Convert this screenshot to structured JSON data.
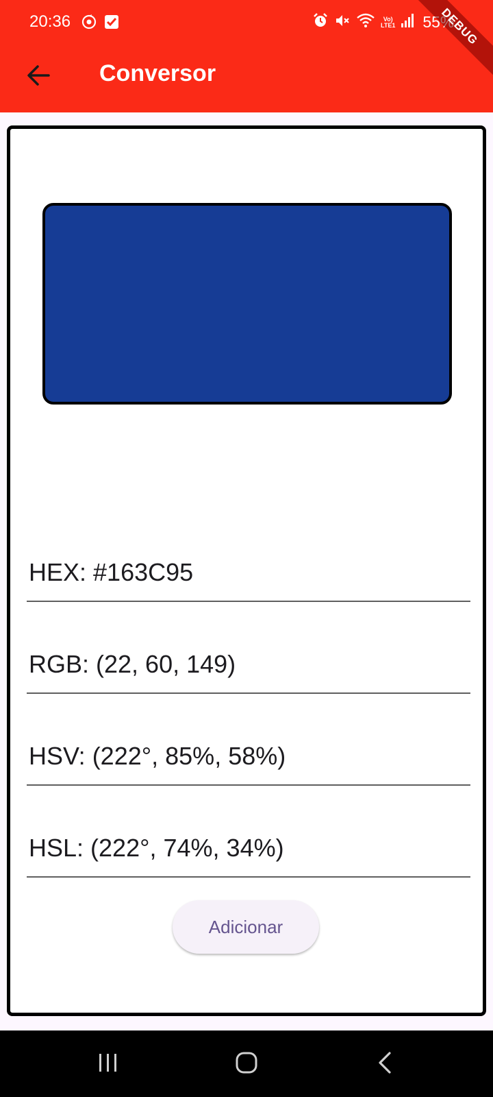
{
  "status_bar": {
    "time": "20:36",
    "battery": "55%",
    "volte_top": "Vo)",
    "volte_bottom": "LTE1",
    "icons": [
      "sync-icon",
      "checkbox-notification-icon",
      "alarm-icon",
      "mute-icon",
      "wifi-icon",
      "volte-icon",
      "signal-icon"
    ]
  },
  "debug_banner": "DEBUG",
  "app_bar": {
    "back_icon": "arrow-back-icon",
    "title": "Conversor",
    "background_color": "#fb2a17"
  },
  "color_preview": {
    "color": "#163C95"
  },
  "fields": [
    {
      "text": "HEX: #163C95"
    },
    {
      "text": "RGB: (22, 60, 149)"
    },
    {
      "text": "HSV: (222°, 85%, 58%)"
    },
    {
      "text": "HSL: (222°, 74%, 34%)"
    }
  ],
  "add_button": {
    "label": "Adicionar"
  },
  "nav_bar": {
    "icons": [
      "recent-apps-icon",
      "home-icon",
      "back-nav-icon"
    ]
  }
}
